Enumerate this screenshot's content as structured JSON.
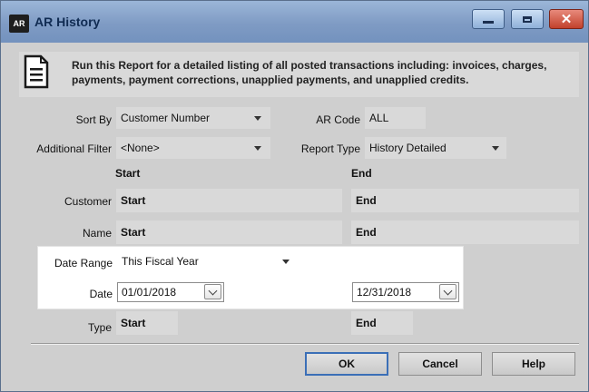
{
  "window": {
    "app_badge": "AR",
    "title": "AR History",
    "controls": [
      "minimize",
      "maximize",
      "close"
    ],
    "close_glyph": "✕"
  },
  "info": {
    "icon": "document-icon",
    "text": "Run this Report for a detailed listing of all posted transactions including: invoices, charges, payments, payment corrections, unapplied payments, and unapplied credits."
  },
  "form": {
    "sort_by": {
      "label": "Sort By",
      "value": "Customer Number"
    },
    "ar_code": {
      "label": "AR Code",
      "value": "ALL"
    },
    "additional_filter": {
      "label": "Additional Filter",
      "value": "<None>"
    },
    "report_type": {
      "label": "Report Type",
      "value": "History Detailed"
    },
    "columns": {
      "start": "Start",
      "end": "End"
    },
    "customer": {
      "label": "Customer",
      "start": "Start",
      "end": "End"
    },
    "name": {
      "label": "Name",
      "start": "Start",
      "end": "End"
    },
    "date_range": {
      "label": "Date Range",
      "value": "This Fiscal Year"
    },
    "date": {
      "label": "Date",
      "start": "01/01/2018",
      "end": "12/31/2018"
    },
    "type": {
      "label": "Type",
      "start": "Start",
      "end": "End"
    }
  },
  "buttons": {
    "ok": "OK",
    "cancel": "Cancel",
    "help": "Help"
  },
  "colors": {
    "title_bar": "#7f9bc4",
    "close_button": "#c1412c",
    "ok_border": "#3b6fb7",
    "panel_bg": "#cfcfcf",
    "field_bg": "#d9d9d9"
  }
}
